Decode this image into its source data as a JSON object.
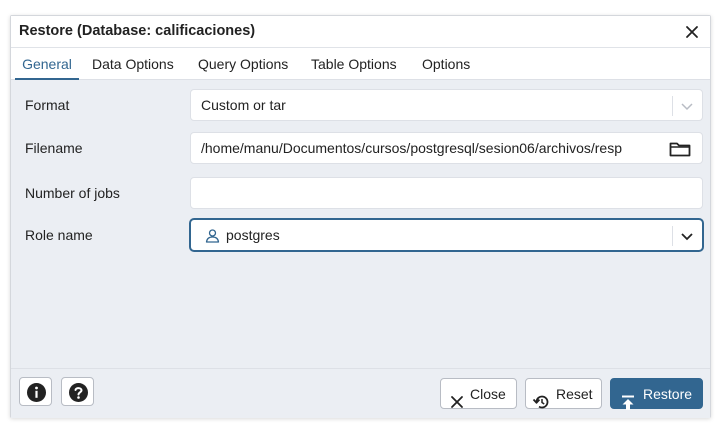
{
  "dialog": {
    "title": "Restore (Database: calificaciones)"
  },
  "tabs": [
    {
      "label": "General",
      "active": true
    },
    {
      "label": "Data Options",
      "active": false
    },
    {
      "label": "Query Options",
      "active": false
    },
    {
      "label": "Table Options",
      "active": false
    },
    {
      "label": "Options",
      "active": false
    }
  ],
  "form": {
    "format": {
      "label": "Format",
      "value": "Custom or tar"
    },
    "filename": {
      "label": "Filename",
      "value": "/home/manu/Documentos/cursos/postgresql/sesion06/archivos/resp"
    },
    "jobs": {
      "label": "Number of jobs",
      "value": ""
    },
    "role": {
      "label": "Role name",
      "value": "postgres"
    }
  },
  "footer": {
    "close_label": "Close",
    "reset_label": "Reset",
    "restore_label": "Restore"
  },
  "colors": {
    "accent": "#326690",
    "panel_bg": "#ebeef3"
  },
  "icons": [
    "close-icon",
    "chevron-down-icon",
    "folder-icon",
    "user-icon",
    "info-icon",
    "help-icon",
    "reset-icon",
    "upload-icon"
  ]
}
